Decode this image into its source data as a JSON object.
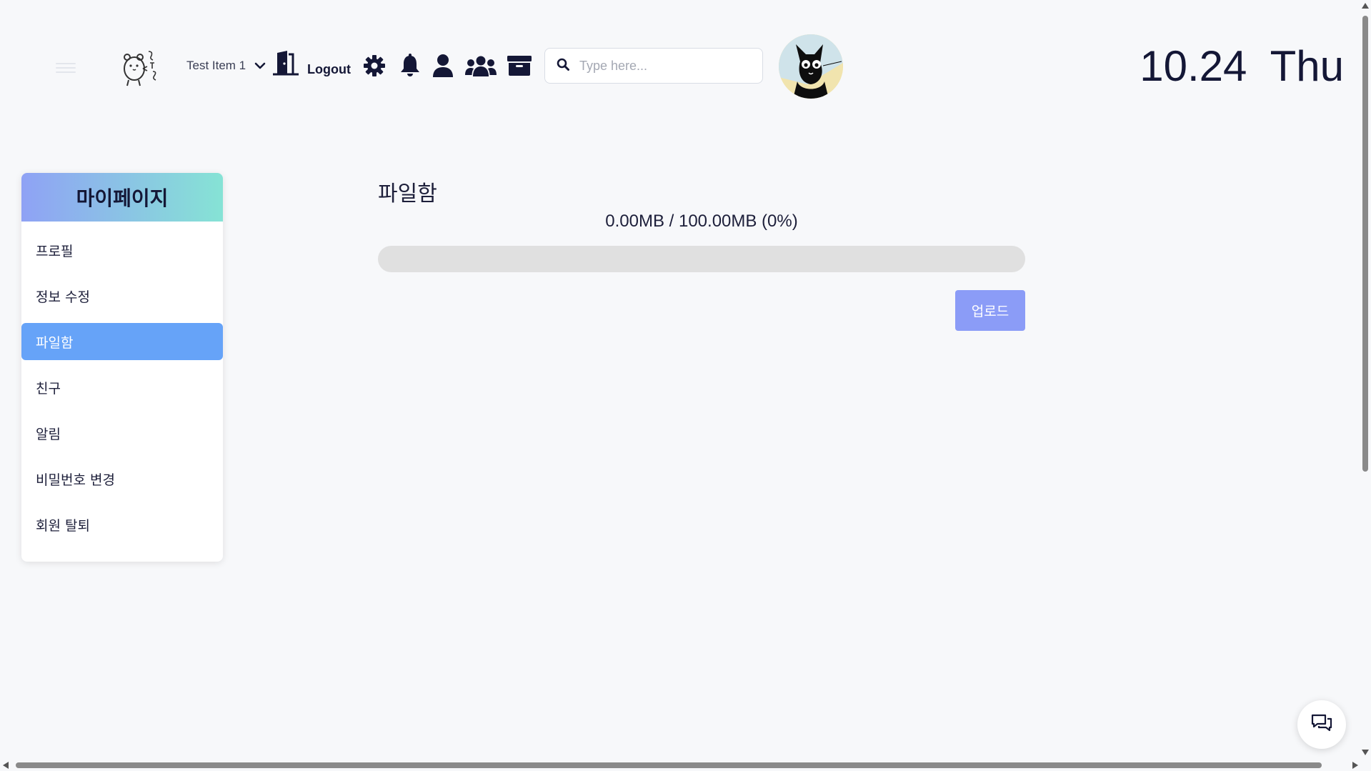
{
  "header": {
    "dropdown_label": "Test Item 1",
    "logout_label": "Logout",
    "search_placeholder": "Type here...",
    "date_text": "10.24  Thu",
    "icons": [
      "menu-icon",
      "logo-icon",
      "chevron-down-icon",
      "door-icon",
      "gear-icon",
      "bell-icon",
      "user-icon",
      "users-icon",
      "archive-icon",
      "search-icon"
    ]
  },
  "sidebar": {
    "title": "마이페이지",
    "items": [
      {
        "label": "프로필",
        "active": false
      },
      {
        "label": "정보 수정",
        "active": false
      },
      {
        "label": "파일함",
        "active": true
      },
      {
        "label": "친구",
        "active": false
      },
      {
        "label": "알림",
        "active": false
      },
      {
        "label": "비밀번호 변경",
        "active": false
      },
      {
        "label": "회원 탈퇴",
        "active": false
      }
    ]
  },
  "main": {
    "title": "파일함",
    "usage_text": "0.00MB / 100.00MB (0%)",
    "usage_percent": 0,
    "upload_label": "업로드"
  },
  "colors": {
    "accent": "#66a3f8",
    "upload_button": "#8b9cf7",
    "header_gradient_start": "#8fa2f5",
    "header_gradient_end": "#86e3d5",
    "text_dark": "#141736"
  }
}
